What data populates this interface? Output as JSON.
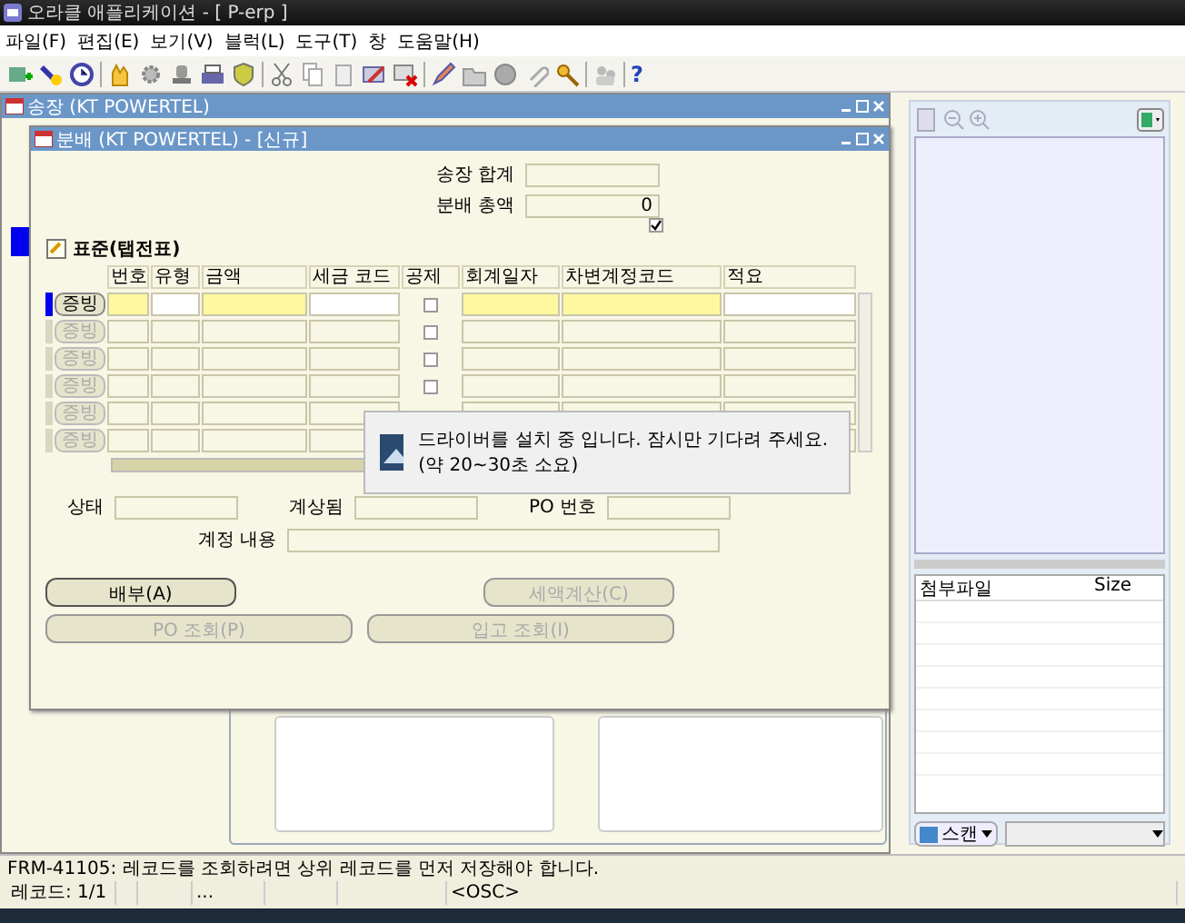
{
  "app_window": {
    "title": "오라클 애플리케이션 - [ P-erp ]"
  },
  "menu": [
    {
      "label": "파일(F)"
    },
    {
      "label": "편집(E)"
    },
    {
      "label": "보기(V)"
    },
    {
      "label": "블럭(L)"
    },
    {
      "label": "도구(T)"
    },
    {
      "label": "창"
    },
    {
      "label": "도움말(H)"
    }
  ],
  "toolbar": {
    "help_glyph": "?"
  },
  "invoice_window": {
    "title": "송장 (KT POWERTEL)"
  },
  "distribution_window": {
    "title": "분배 (KT POWERTEL) - [신규]",
    "invoice_total": {
      "label": "송장 합계"
    },
    "distribution_total": {
      "label": "분배 총액",
      "value": "0"
    },
    "flag_checked": true,
    "block_title": "표준(탭전표)",
    "columns": [
      "번호",
      "유형",
      "금액",
      "세금 코드",
      "공제",
      "회계일자",
      "차변계정코드",
      "적요"
    ],
    "rows": [
      {
        "button": "증빙",
        "enabled": true,
        "selected": true,
        "deducted": false
      },
      {
        "button": "증빙",
        "enabled": false,
        "selected": false,
        "deducted": false
      },
      {
        "button": "증빙",
        "enabled": false,
        "selected": false,
        "deducted": false
      },
      {
        "button": "증빙",
        "enabled": false,
        "selected": false,
        "deducted": false
      },
      {
        "button": "증빙",
        "enabled": false,
        "selected": false
      },
      {
        "button": "증빙",
        "enabled": false,
        "selected": false
      }
    ],
    "fields": {
      "status": "상태",
      "accounted": "계상됨",
      "po_number": "PO 번호",
      "account_desc": "계정 내용"
    },
    "buttons": [
      {
        "label": "배부(A)",
        "enabled": true
      },
      {
        "label": "세액계산(C)",
        "enabled": false
      },
      {
        "label": "PO 조회(P)",
        "enabled": false
      },
      {
        "label": "입고 조회(I)",
        "enabled": false
      }
    ]
  },
  "dialog": {
    "message": "드라이버를 설치 중 입니다. 잠시만 기다려 주세요.(약 20~30초 소요)"
  },
  "attachments": {
    "columns": [
      "첨부파일",
      "Size"
    ],
    "scan_button": "스캔"
  },
  "status_bar": {
    "message": "FRM-41105: 레코드를 조회하려면 상위 레코드를 먼저 저장해야 합니다.",
    "record": "레코드: 1/1",
    "segment_3": "...",
    "mode": "<OSC>"
  }
}
